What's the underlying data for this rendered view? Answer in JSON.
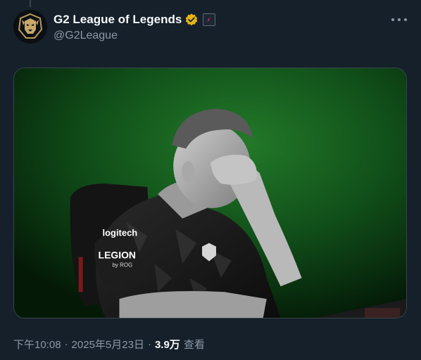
{
  "tweet": {
    "display_name": "G2 League of Legends",
    "handle": "@G2League",
    "verified_badge_color": "#e7b416",
    "affiliate_badge_color": "#e0245e",
    "time": "下午10:08",
    "date": "2025年5月23日",
    "separator": "·",
    "views_count": "3.9万",
    "views_label": "查看"
  },
  "media": {
    "jersey_sponsor_1": "logitech",
    "jersey_sponsor_2": "LEGION",
    "jersey_sponsor_3": "by ROG",
    "background_color": "#0f4a15"
  },
  "icons": {
    "avatar": "g2-logo-icon",
    "verified": "gold-verified-check-icon",
    "affiliate": "affiliate-badge-icon",
    "more": "more-horizontal-icon"
  }
}
